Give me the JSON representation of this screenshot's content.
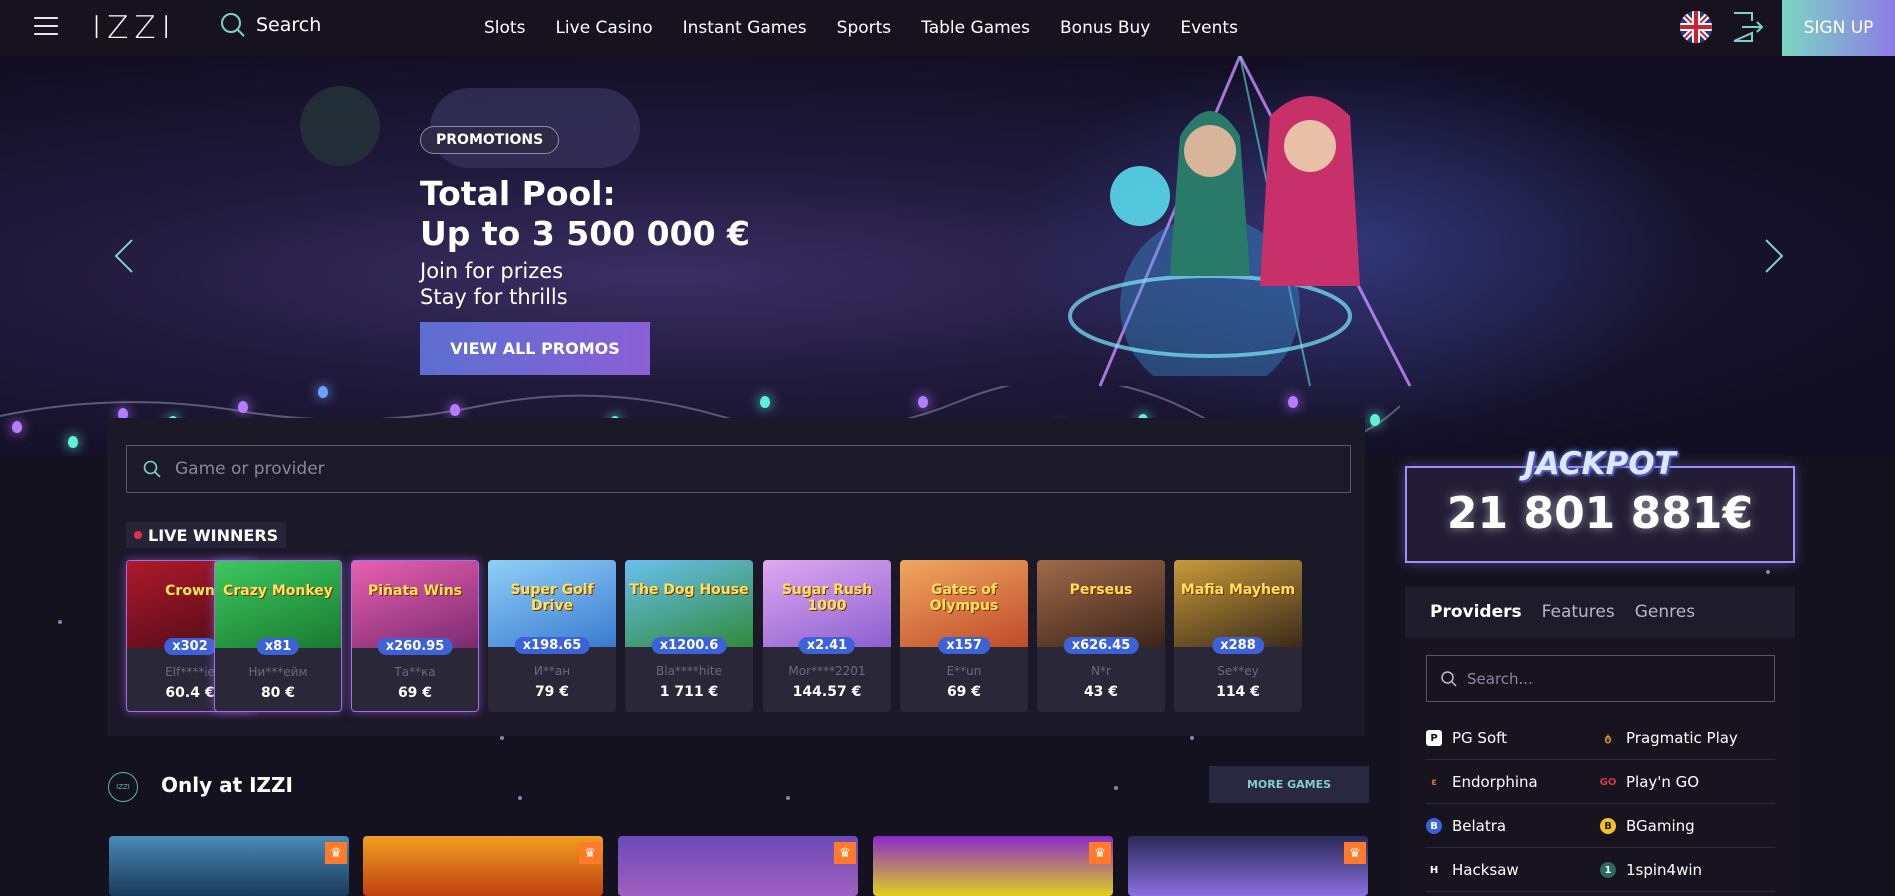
{
  "header": {
    "logo": "IZZI",
    "search_label": "Search",
    "nav": [
      "Slots",
      "Live Casino",
      "Instant Games",
      "Sports",
      "Table Games",
      "Bonus Buy",
      "Events"
    ],
    "signup_label": "SIGN UP"
  },
  "hero": {
    "tag": "PROMOTIONS",
    "title_line1": "Total Pool:",
    "title_line2": "Up to 3 500 000 €",
    "sub_line1": "Join for prizes",
    "sub_line2": "Stay for thrills",
    "button": "VIEW ALL PROMOS"
  },
  "game_search": {
    "placeholder": "Game or provider"
  },
  "live_winners": {
    "label": "LIVE WINNERS",
    "items": [
      {
        "game": "Crown",
        "mult": "x302",
        "name": "Elf****ie",
        "amount": "60.4 €",
        "color": "#8a1a2a"
      },
      {
        "game": "Crazy Monkey",
        "mult": "x81",
        "name": "Ни***ейм",
        "amount": "80 €",
        "color": "#2aa84a"
      },
      {
        "game": "Piñata Wins",
        "mult": "x260.95",
        "name": "Та**ка",
        "amount": "69 €",
        "color": "#c44fa0"
      },
      {
        "game": "Super Golf Drive",
        "mult": "x198.65",
        "name": "И**ан",
        "amount": "79 €",
        "color": "#5fa8e0"
      },
      {
        "game": "The Dog House",
        "mult": "x1200.6",
        "name": "Bla****hite",
        "amount": "1 711 €",
        "color": "#4fa0d8"
      },
      {
        "game": "Sugar Rush 1000",
        "mult": "x2.41",
        "name": "Mor****2201",
        "amount": "144.57 €",
        "color": "#c890e8"
      },
      {
        "game": "Gates of Olympus",
        "mult": "x157",
        "name": "E**un",
        "amount": "69 €",
        "color": "#e07a30"
      },
      {
        "game": "Perseus",
        "mult": "x626.45",
        "name": "N*r",
        "amount": "43 €",
        "color": "#7a4a30"
      },
      {
        "game": "Mafia Mayhem",
        "mult": "x288",
        "name": "Se**ey",
        "amount": "114 €",
        "color": "#4a3a2a"
      }
    ]
  },
  "only_at": {
    "title": "Only at IZZI",
    "icon_text": "IZZI",
    "more_button": "MORE GAMES"
  },
  "jackpot": {
    "label": "JACKPOT",
    "value": "21 801 881€"
  },
  "providers": {
    "tabs": [
      "Providers",
      "Features",
      "Genres"
    ],
    "search_placeholder": "Search...",
    "items": [
      {
        "name": "PG Soft",
        "icon": "pg-soft-icon",
        "color": "#ffffff"
      },
      {
        "name": "Pragmatic Play",
        "icon": "pragmatic-play-icon",
        "color": "#f39c2a"
      },
      {
        "name": "Endorphina",
        "icon": "endorphina-icon",
        "color": "#e8742a"
      },
      {
        "name": "Play'n GO",
        "icon": "playngo-icon",
        "color": "#e0334b"
      },
      {
        "name": "Belatra",
        "icon": "belatra-icon",
        "color": "#3b62d8"
      },
      {
        "name": "BGaming",
        "icon": "bgaming-icon",
        "color": "#f5c02a"
      },
      {
        "name": "Hacksaw",
        "icon": "hacksaw-icon",
        "color": "#ffffff"
      },
      {
        "name": "1spin4win",
        "icon": "1spin4win-icon",
        "color": "#4ac8a0"
      }
    ]
  },
  "colors": {
    "accent": "#8d7ce6",
    "teal": "#7fd1c8",
    "background": "#15121f"
  }
}
